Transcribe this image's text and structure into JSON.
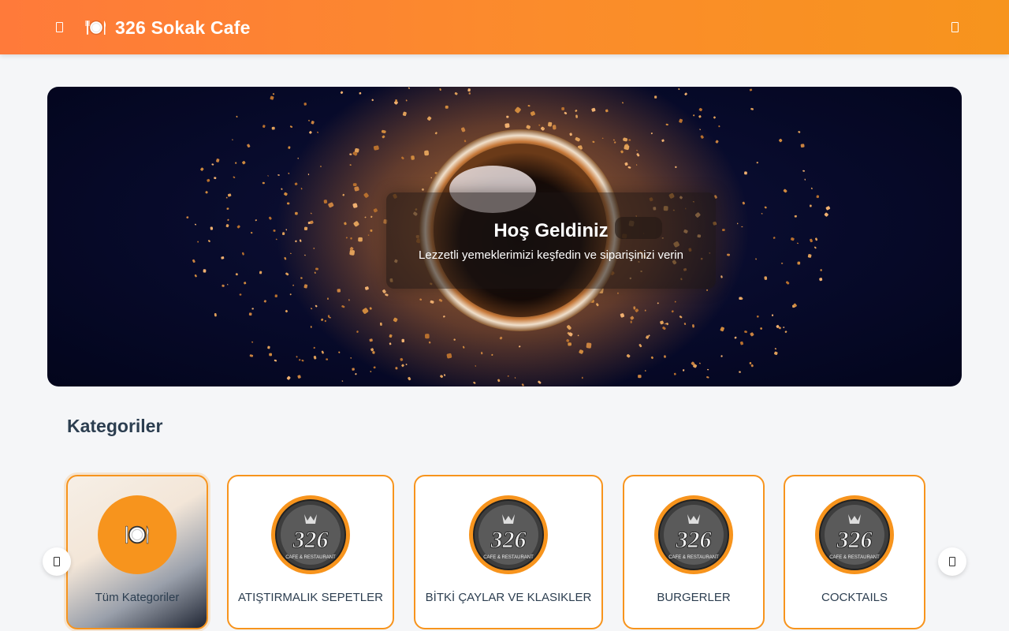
{
  "header": {
    "menu_icon": "menu-icon",
    "brand_icon": "plate-cutlery-icon",
    "title": "326 Sokak Cafe",
    "cart_icon": "cart-icon",
    "gradient_colors": [
      "#ff7a3a",
      "#f7941d"
    ]
  },
  "hero": {
    "title": "Hoş Geldiniz",
    "subtitle": "Lezzetli yemeklerimizi keşfedin ve siparişinizi verin",
    "image": "coffee-cup-with-grounds"
  },
  "categories": {
    "title": "Kategoriler",
    "items": [
      {
        "label": "Tüm Kategoriler",
        "icon": "plate-cutlery-icon",
        "active": true
      },
      {
        "label": "ATIŞTIRMALIK SEPETLER",
        "logo_text": "326",
        "logo_caption": "CAFE & RESTAURANT",
        "active": false
      },
      {
        "label": "BİTKİ ÇAYLAR VE KLASIKLER",
        "logo_text": "326",
        "logo_caption": "CAFE & RESTAURANT",
        "active": false
      },
      {
        "label": "BURGERLER",
        "logo_text": "326",
        "logo_caption": "CAFE & RESTAURANT",
        "active": false
      },
      {
        "label": "COCKTAILS",
        "logo_text": "326",
        "logo_caption": "CAFE & RESTAURANT",
        "active": false
      }
    ],
    "prev_icon": "chevron-left-icon",
    "next_icon": "chevron-right-icon"
  },
  "colors": {
    "accent": "#f7941d",
    "text": "#2c3e50",
    "background": "#f5f6f8"
  }
}
